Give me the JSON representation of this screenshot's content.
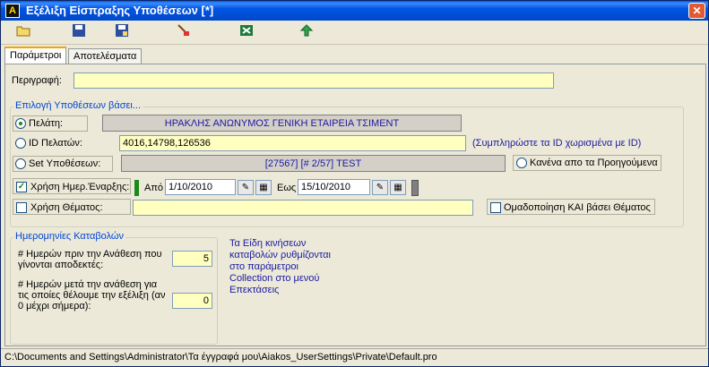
{
  "window": {
    "title": "Εξέλιξη Είσπραξης Υποθέσεων [*]",
    "app_letter": "A",
    "close_glyph": "✕"
  },
  "tabs": [
    "Παράμετροι",
    "Αποτελέσματα"
  ],
  "description": {
    "label": "Περιγραφή:",
    "value": ""
  },
  "selection": {
    "title": "Επιλογή Υποθέσεων βάσει...",
    "client_label": "Πελάτη:",
    "client_value": "ΗΡΑΚΛΗΣ ΑΝΩΝΥΜΟΣ ΓΕΝΙΚΗ ΕΤΑΙΡΕΙΑ ΤΣΙΜΕΝΤ",
    "client_ids_label": "ID Πελατών:",
    "client_ids_value": "4016,14798,126536",
    "client_ids_hint": "(Συμπληρώστε τα ID χωρισμένα με ID)",
    "set_label": "Set Υποθέσεων:",
    "set_value": "[27567] [# 2/57] TEST",
    "none_label": "Κανένα απο τα Προηγούμενα",
    "use_date_label": "Χρήση Ημερ.Έναρξης:",
    "from_label": "Από",
    "from_value": "1/10/2010",
    "to_label": "Εως",
    "to_value": "15/10/2010",
    "use_subject_label": "Χρήση Θέματος:",
    "subject_value": "",
    "group_by_subject_label": "Ομαδοποίηση ΚΑΙ βάσει Θέματος"
  },
  "payments": {
    "title": "Ημερομηνίες Καταβολών",
    "days_before_label": "# Ημερών πριν την Ανάθεση που γίνονται αποδεκτές:",
    "days_before_value": "5",
    "days_after_label": "# Ημερών μετά την ανάθεση για τις οποίες θέλουμε την εξέλιξη (αν 0 μέχρι σήμερα):",
    "days_after_value": "0"
  },
  "info_text": "Τα Είδη κινήσεων καταβολών ρυθμίζονται στο παράμετροι Collection στο μενού Επεκτάσεις",
  "status_path": "C:\\Documents and Settings\\Administrator\\Τα έγγραφά μου\\Aiakos_UserSettings\\Private\\Default.pro",
  "colors": {
    "title_bar": "#0054e3",
    "field_yellow": "#ffffc0",
    "label_blue": "#0046d5"
  }
}
